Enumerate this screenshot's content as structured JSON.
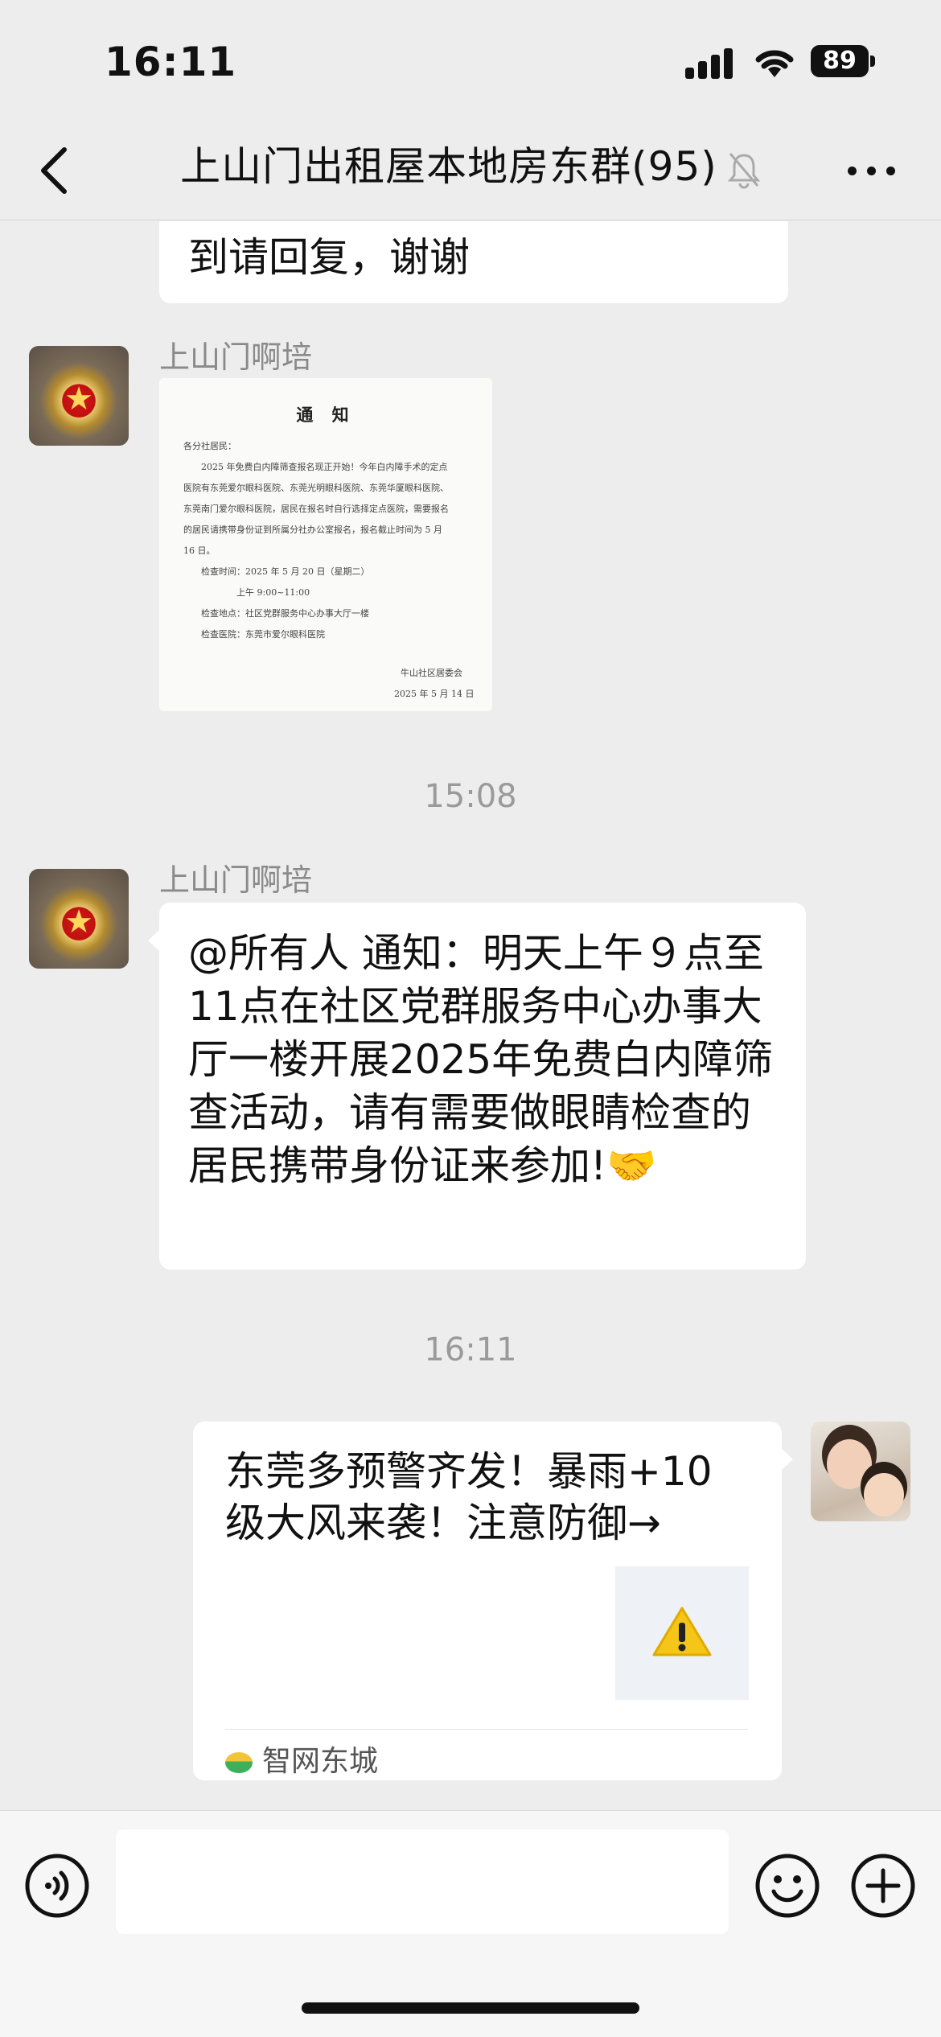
{
  "status_bar": {
    "time": "16:11",
    "battery": "89"
  },
  "header": {
    "title": "上山门出租屋本地房东群(95)"
  },
  "messages": [
    {
      "type": "text_partial",
      "text": "到请回复，谢谢"
    },
    {
      "type": "image",
      "sender": "上山门啊培",
      "notice": {
        "title": "通 知",
        "lines": [
          "各分社居民：",
          "　　2025 年免费白内障筛查报名现正开始！今年白内障手术的定点",
          "医院有东莞爱尔眼科医院、东莞光明眼科医院、东莞华厦眼科医院、",
          "东莞南门爱尔眼科医院，居民在报名时自行选择定点医院，需要报名",
          "的居民请携带身份证到所属分社办公室报名，报名截止时间为 5 月",
          "16 日。",
          "　　检查时间：2025 年 5 月 20 日（星期二）",
          "　　　　　　上午 9:00~11:00",
          "　　检查地点：社区党群服务中心办事大厅一楼",
          "　　检查医院：东莞市爱尔眼科医院"
        ],
        "signature": "牛山社区居委会",
        "date": "2025 年 5 月 14 日"
      }
    },
    {
      "type": "timestamp",
      "text": "15:08"
    },
    {
      "type": "text",
      "sender": "上山门啊培",
      "text": "@所有人 通知：明天上午９点至11点在社区党群服务中心办事大厅一楼开展2025年免费白内障筛查活动，请有需要做眼睛检查的居民携带身份证来参加!🤝"
    },
    {
      "type": "timestamp",
      "text": "16:11"
    },
    {
      "type": "link_card",
      "title": "东莞多预警齐发！暴雨+10级大风来袭！注意防御→",
      "source": "智网东城"
    }
  ]
}
